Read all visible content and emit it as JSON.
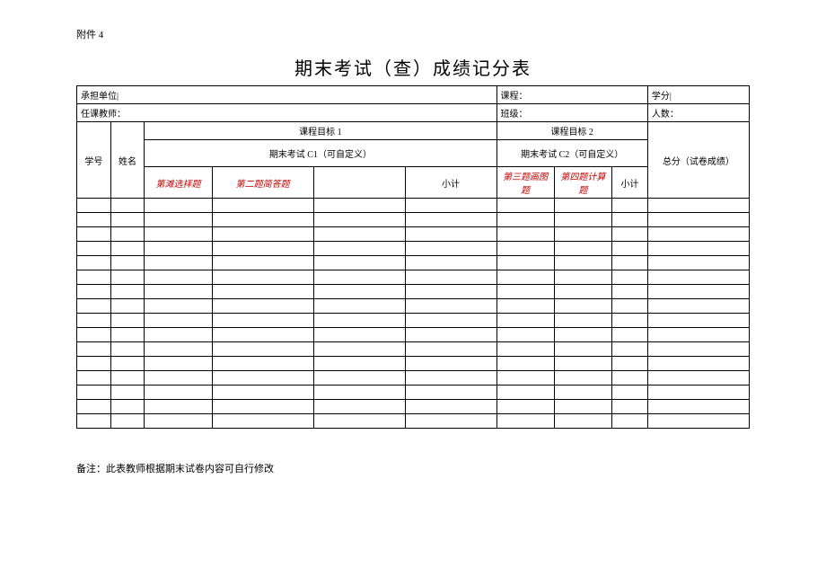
{
  "attachment_label": "附件 4",
  "title": "期末考试（查）成绩记分表",
  "header": {
    "unit_label": "承担单位|",
    "course_label": "课程：",
    "credit_label": "学分|",
    "teacher_label": "任课教师：",
    "class_label": "班级：",
    "count_label": "人数："
  },
  "table_header": {
    "xuehao": "学号",
    "xingming": "姓名",
    "mubiao1": "课程目标 1",
    "mubiao2": "课程目标 2",
    "exam_c1": "期末考试 C1（可自定义）",
    "exam_c2": "期末考试 C2（可自定义）",
    "zongfen": "总分（试卷成绩）",
    "q1": "第滩选拝题",
    "q2": "第二题简答题",
    "xiaoji": "小计",
    "q3": "第三题画图题",
    "q4": "第四题计算题"
  },
  "data_rows_count": 16,
  "footnote": "备注：此表教师根据期末试卷内容可自行修改"
}
